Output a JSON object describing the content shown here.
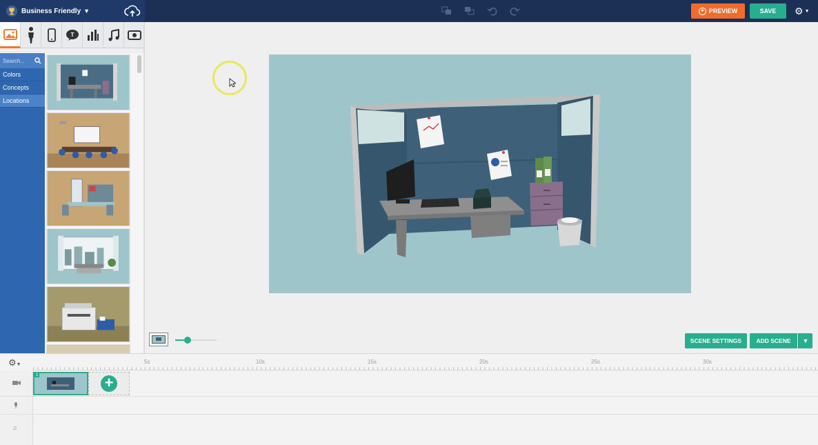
{
  "topbar": {
    "theme_name": "Business Friendly",
    "preview_label": "PREVIEW",
    "save_label": "SAVE"
  },
  "category_tabs": [
    {
      "name": "backgrounds",
      "active": true
    },
    {
      "name": "characters"
    },
    {
      "name": "devices"
    },
    {
      "name": "text-balloons"
    },
    {
      "name": "charts"
    },
    {
      "name": "music"
    },
    {
      "name": "video"
    }
  ],
  "sidebar": {
    "search_placeholder": "Search...",
    "items": [
      {
        "label": "Colors"
      },
      {
        "label": "Concepts"
      },
      {
        "label": "Locations",
        "active": true
      }
    ]
  },
  "assets": [
    "office-cubicle",
    "conference-room",
    "workshop-desk",
    "window-office",
    "copy-room"
  ],
  "stage": {
    "background": "office-cubicle",
    "bg_color": "#9ec5c9"
  },
  "zoom": {
    "level": 0.3
  },
  "bottom_buttons": {
    "scene_settings_label": "SCENE SETTINGS",
    "add_scene_label": "ADD SCENE"
  },
  "timeline": {
    "ticks": [
      "5s",
      "10s",
      "15s",
      "20s",
      "25s",
      "30s"
    ],
    "scenes": [
      {
        "number": "1"
      }
    ]
  },
  "colors": {
    "topbar": "#1c2f55",
    "sidebar": "#2f66b0",
    "accent_green": "#27ae8f",
    "accent_orange": "#ef6c2c"
  }
}
